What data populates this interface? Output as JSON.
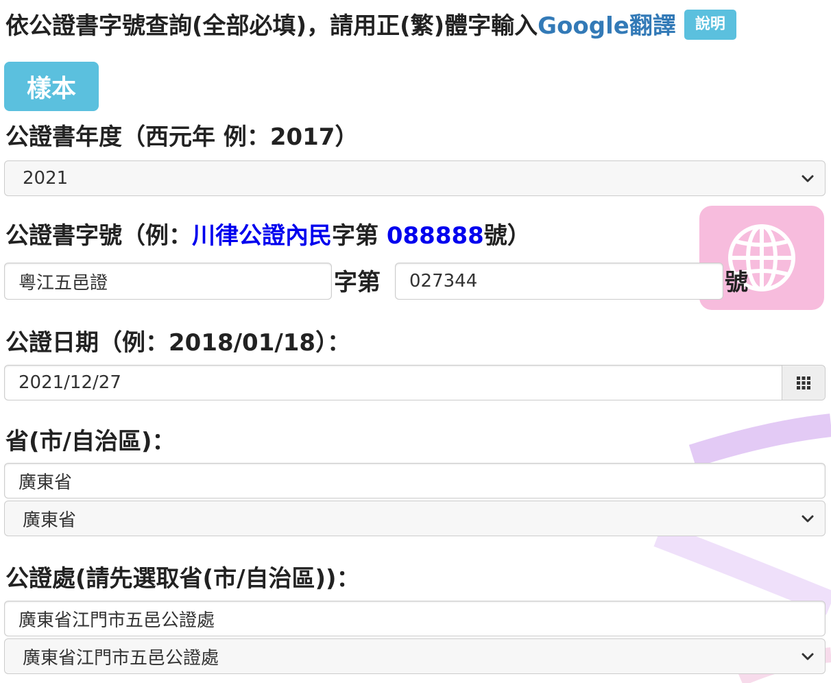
{
  "header": {
    "text": "依公證書字號查詢(全部必填)，請用正(繁)體字輸入",
    "google_link": "Google翻譯",
    "help_button": "說明"
  },
  "sample_button": "樣本",
  "year": {
    "label": "公證書年度（西元年 例：2017）",
    "selected": "2021"
  },
  "cert_number": {
    "label_prefix": "公證書字號（例：",
    "label_example_word": "川律公證內民",
    "label_mid": "字第 ",
    "label_example_num": "088888",
    "label_suffix": "號）",
    "word_value": "粵江五邑證",
    "word_suffix": "字第",
    "number_value": "027344",
    "number_suffix": "號"
  },
  "date": {
    "label": "公證日期（例：2018/01/18）：",
    "value": "2021/12/27"
  },
  "province": {
    "label": "省(市/自治區)：",
    "input_value": "廣東省",
    "selected": "廣東省"
  },
  "office": {
    "label": "公證處(請先選取省(市/自治區))：",
    "input_value": "廣東省江門市五邑公證處",
    "selected": "廣東省江門市五邑公證處"
  },
  "colors": {
    "info_button": "#5bc0de",
    "link_blue": "#337ab7",
    "example_blue": "#0000ee",
    "translate_widget": "#f7b9dc"
  },
  "icons": {
    "translate": "globe-icon",
    "calendar": "calendar-grid-icon",
    "select_arrow": "chevron-down-icon"
  }
}
